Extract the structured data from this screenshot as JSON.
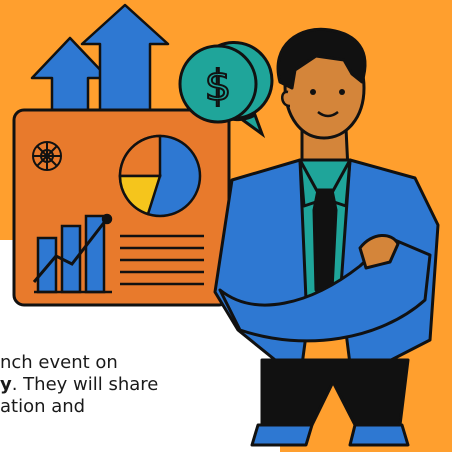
{
  "illustration": {
    "subject": "businessman with crossed arms beside a dashboard board",
    "dollar_bubble_symbol": "$",
    "colors": {
      "background_orange": "#ff9f2e",
      "board_orange": "#e87a2c",
      "blue": "#2e78d2",
      "teal": "#1fa59a",
      "yellow": "#f5c51c",
      "dark": "#111111"
    }
  },
  "text": {
    "line1_part1": "nch event on",
    "line2_bold": "y",
    "line2_part2": ". They will share",
    "line3_part1": "ation and"
  }
}
